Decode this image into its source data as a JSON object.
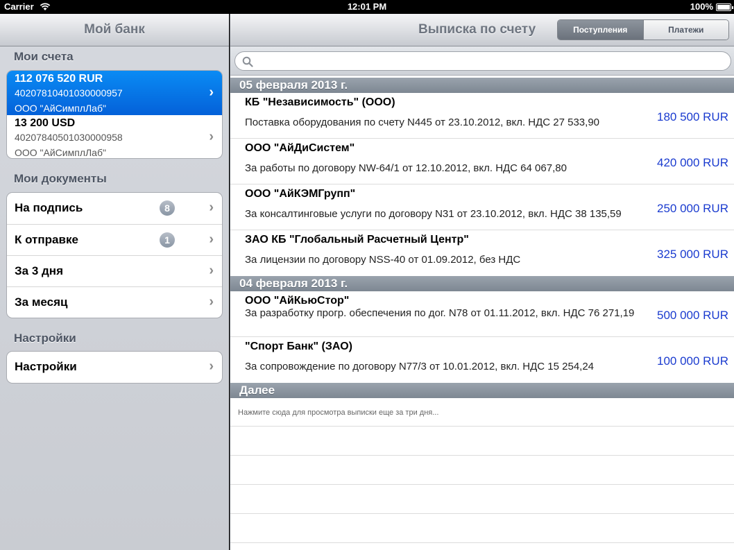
{
  "status": {
    "carrier": "Carrier",
    "time": "12:01 PM",
    "battery": "100%"
  },
  "left": {
    "title": "Мой банк",
    "accounts_header": "Мои счета",
    "accounts": [
      {
        "amount": "112 076 520 RUR",
        "number": "40207810401030000957",
        "org": "ООО \"АйСимплЛаб\""
      },
      {
        "amount": "13 200 USD",
        "number": "40207840501030000958",
        "org": "ООО \"АйСимплЛаб\""
      }
    ],
    "docs_header": "Мои документы",
    "docs": [
      {
        "label": "На подпись",
        "badge": "8"
      },
      {
        "label": "К отправке",
        "badge": "1"
      },
      {
        "label": "За 3 дня"
      },
      {
        "label": "За месяц"
      }
    ],
    "settings_header": "Настройки",
    "settings_item": "Настройки"
  },
  "right": {
    "title": "Выписка по счету",
    "seg_incoming": "Поступления",
    "seg_payments": "Платежи",
    "days": [
      {
        "date": "05 февраля 2013 г.",
        "items": [
          {
            "name": "КБ \"Независимость\" (ООО)",
            "desc": "Поставка оборудования по счету N445 от 23.10.2012, вкл. НДС 27 533,90",
            "amount": "180 500 RUR"
          },
          {
            "name": "ООО \"АйДиСистем\"",
            "desc": "За работы по договору NW-64/1 от 12.10.2012, вкл. НДС 64 067,80",
            "amount": "420 000 RUR"
          },
          {
            "name": "ООО \"АйКЭМГрупп\"",
            "desc": "За консалтинговые услуги по договору N31 от 23.10.2012, вкл. НДС 38 135,59",
            "amount": "250 000 RUR"
          },
          {
            "name": "ЗАО КБ \"Глобальный Расчетный Центр\"",
            "desc": "За лицензии по договору NSS-40 от 01.09.2012, без НДС",
            "amount": "325 000 RUR"
          }
        ]
      },
      {
        "date": "04 февраля 2013 г.",
        "items": [
          {
            "name": "ООО \"АйКьюСтор\"",
            "desc": "За разработку прогр. обеспечения по дог. N78 от 01.11.2012, вкл. НДС 76 271,19",
            "amount": "500 000 RUR"
          },
          {
            "name": "\"Спорт Банк\" (ЗАО)",
            "desc": "За сопровождение по договору N77/3 от 10.01.2012, вкл. НДС 15 254,24",
            "amount": "100 000 RUR"
          }
        ]
      }
    ],
    "more_header": "Далее",
    "more_text": "Нажмите сюда для просмотра выписки еще за три дня..."
  }
}
